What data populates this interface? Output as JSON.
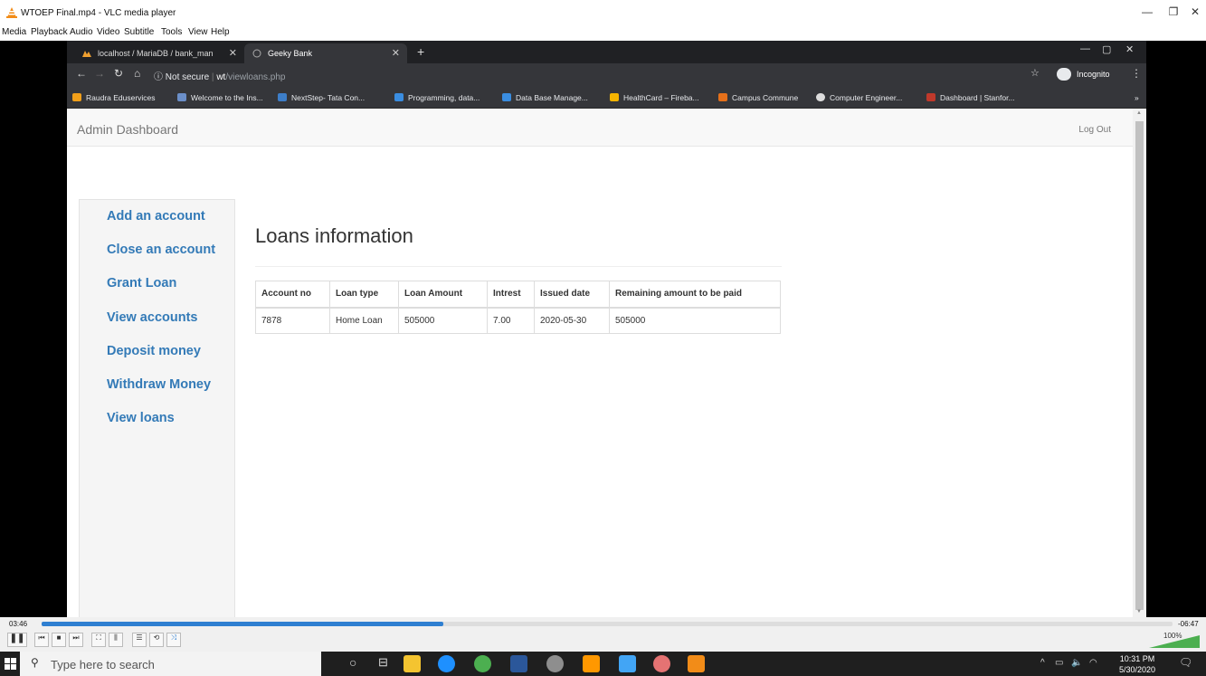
{
  "vlc": {
    "title": "WTOEP Final.mp4 - VLC media player",
    "menu": [
      "Media",
      "Playback",
      "Audio",
      "Video",
      "Subtitle",
      "Tools",
      "View",
      "Help"
    ],
    "time_elapsed": "03:46",
    "time_remaining": "-06:47",
    "progress_fraction": 0.355,
    "volume": "100%"
  },
  "browser": {
    "tabs": [
      {
        "label": "localhost / MariaDB / bank_man"
      },
      {
        "label": "Geeky Bank"
      }
    ],
    "security": "Not secure",
    "url_host": "wt",
    "url_path": "/viewloans.php",
    "profile": "Incognito",
    "bookmarks": [
      "Raudra Eduservices",
      "Welcome to the Ins...",
      "NextStep- Tata Con...",
      "Programming, data...",
      "Data Base Manage...",
      "HealthCard – Fireba...",
      "Campus Commune",
      "Computer Engineer...",
      "Dashboard | Stanfor..."
    ],
    "more_bookmarks": "»"
  },
  "page": {
    "brand": "Admin Dashboard",
    "logout": "Log Out",
    "sidebar": [
      "Add an account",
      "Close an account",
      "Grant Loan",
      "View accounts",
      "Deposit money",
      "Withdraw Money",
      "View loans"
    ],
    "heading": "Loans information",
    "table": {
      "headers": [
        "Account no",
        "Loan type",
        "Loan Amount",
        "Intrest",
        "Issued date",
        "Remaining amount to be paid"
      ],
      "rows": [
        [
          "7878",
          "Home Loan",
          "505000",
          "7.00",
          "2020-05-30",
          "505000"
        ]
      ]
    }
  },
  "taskbar": {
    "search_placeholder": "Type here to search",
    "time": "10:31 PM",
    "date": "5/30/2020"
  }
}
